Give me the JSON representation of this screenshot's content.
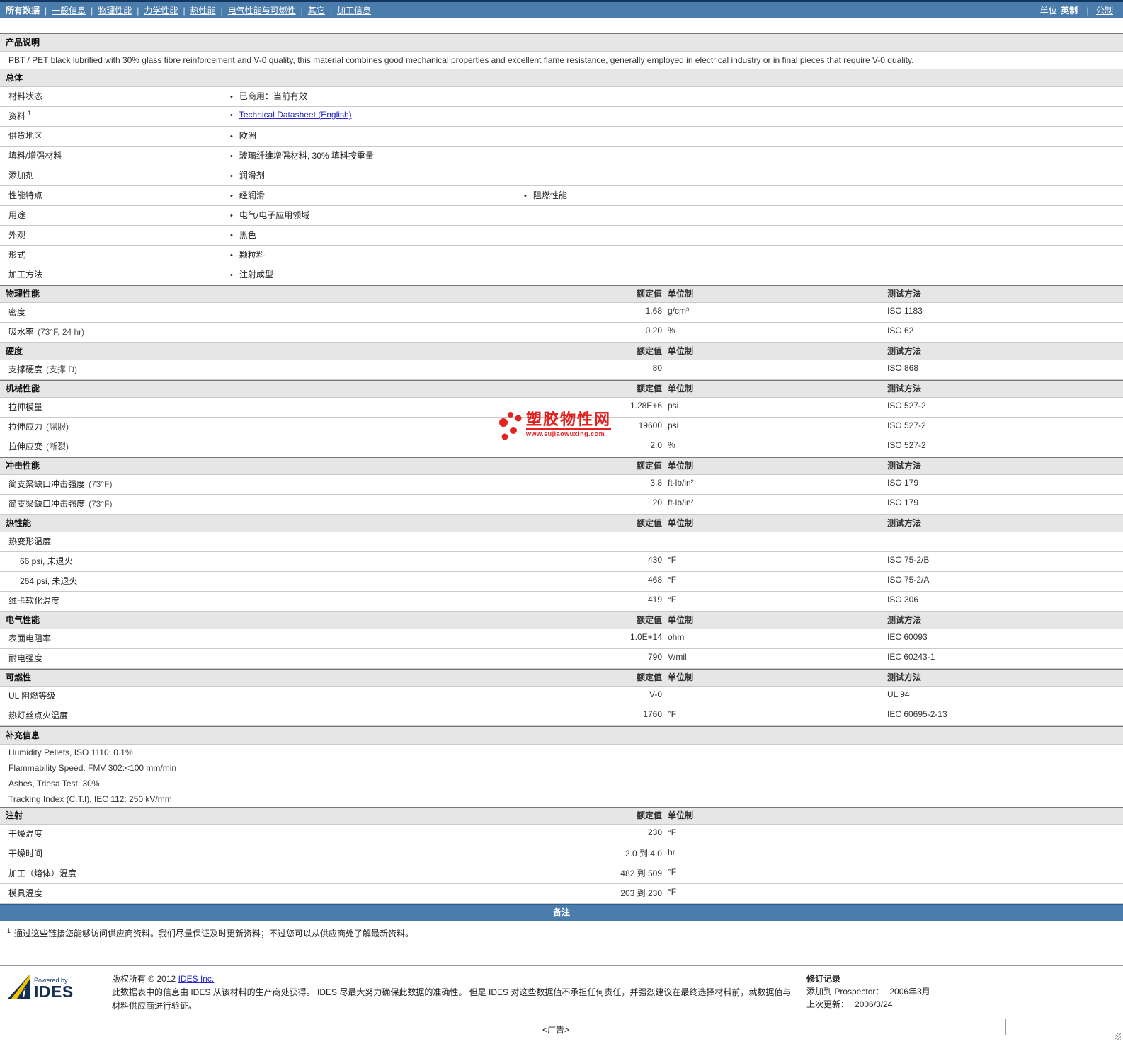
{
  "nav": {
    "tabs": [
      {
        "label": "所有数据",
        "active": true
      },
      {
        "label": "一般信息",
        "active": false
      },
      {
        "label": "物理性能",
        "active": false
      },
      {
        "label": "力学性能",
        "active": false
      },
      {
        "label": "热性能",
        "active": false
      },
      {
        "label": "电气性能与可燃性",
        "active": false
      },
      {
        "label": "其它",
        "active": false
      },
      {
        "label": "加工信息",
        "active": false
      }
    ],
    "units_label": "单位",
    "unit_current": "英制",
    "unit_alt": "公制"
  },
  "product": {
    "section_title": "产品说明",
    "description": "PBT / PET black lubrified with 30% glass fibre reinforcement and V-0 quality, this material combines good mechanical properties and excellent flame resistance, generally employed in electrical industry or in final pieces that require V-0 quality."
  },
  "general": {
    "section_title": "总体",
    "rows": [
      {
        "label": "材料状态",
        "sup": "",
        "bullets": [
          {
            "text": "已商用：当前有效",
            "link": false
          }
        ]
      },
      {
        "label": "资料",
        "sup": "1",
        "bullets": [
          {
            "text": "Technical Datasheet (English)",
            "link": true
          }
        ]
      },
      {
        "label": "供货地区",
        "sup": "",
        "bullets": [
          {
            "text": "欧洲",
            "link": false
          }
        ]
      },
      {
        "label": "填料/增强材料",
        "sup": "",
        "bullets": [
          {
            "text": "玻璃纤维增强材料, 30% 填料按重量",
            "link": false
          }
        ]
      },
      {
        "label": "添加剂",
        "sup": "",
        "bullets": [
          {
            "text": "润滑剂",
            "link": false
          }
        ]
      },
      {
        "label": "性能特点",
        "sup": "",
        "bullets": [
          {
            "text": "经润滑",
            "link": false
          },
          {
            "text": "阻燃性能",
            "link": false
          }
        ]
      },
      {
        "label": "用途",
        "sup": "",
        "bullets": [
          {
            "text": "电气/电子应用领域",
            "link": false
          }
        ]
      },
      {
        "label": "外观",
        "sup": "",
        "bullets": [
          {
            "text": "黑色",
            "link": false
          }
        ]
      },
      {
        "label": "形式",
        "sup": "",
        "bullets": [
          {
            "text": "颗粒料",
            "link": false
          }
        ]
      },
      {
        "label": "加工方法",
        "sup": "",
        "bullets": [
          {
            "text": "注射成型",
            "link": false
          }
        ]
      }
    ]
  },
  "columns": {
    "value": "额定值",
    "unit": "单位制",
    "method": "测试方法"
  },
  "property_sections": [
    {
      "title": "物理性能",
      "rows": [
        {
          "label": "密度",
          "cond": "",
          "value": "1.68",
          "unit": "g/cm³",
          "method": "ISO 1183"
        },
        {
          "label": "吸水率",
          "cond": "(73°F, 24 hr)",
          "value": "0.20",
          "unit": "%",
          "method": "ISO 62"
        }
      ]
    },
    {
      "title": "硬度",
      "rows": [
        {
          "label": "支撑硬度",
          "cond": "(支撑 D)",
          "value": "80",
          "unit": "",
          "method": "ISO 868"
        }
      ]
    },
    {
      "title": "机械性能",
      "rows": [
        {
          "label": "拉伸模量",
          "cond": "",
          "value": "1.28E+6",
          "unit": "psi",
          "method": "ISO 527-2"
        },
        {
          "label": "拉伸应力",
          "cond": "(屈服)",
          "value": "19600",
          "unit": "psi",
          "method": "ISO 527-2"
        },
        {
          "label": "拉伸应变",
          "cond": "(断裂)",
          "value": "2.0",
          "unit": "%",
          "method": "ISO 527-2"
        }
      ]
    },
    {
      "title": "冲击性能",
      "rows": [
        {
          "label": "简支梁缺口冲击强度",
          "cond": "(73°F)",
          "value": "3.8",
          "unit": "ft·lb/in²",
          "method": "ISO 179"
        },
        {
          "label": "简支梁缺口冲击强度",
          "cond": "(73°F)",
          "value": "20",
          "unit": "ft·lb/in²",
          "method": "ISO 179"
        }
      ]
    },
    {
      "title": "热性能",
      "rows": [
        {
          "label": "热变形温度",
          "cond": "",
          "value": "",
          "unit": "",
          "method": "",
          "subheader": true
        },
        {
          "label": "66 psi, 未退火",
          "cond": "",
          "value": "430",
          "unit": "°F",
          "method": "ISO 75-2/B",
          "indent": true
        },
        {
          "label": "264 psi, 未退火",
          "cond": "",
          "value": "468",
          "unit": "°F",
          "method": "ISO 75-2/A",
          "indent": true
        },
        {
          "label": "维卡软化温度",
          "cond": "",
          "value": "419",
          "unit": "°F",
          "method": "ISO 306"
        }
      ]
    },
    {
      "title": "电气性能",
      "rows": [
        {
          "label": "表面电阻率",
          "cond": "",
          "value": "1.0E+14",
          "unit": "ohm",
          "method": "IEC 60093"
        },
        {
          "label": "耐电强度",
          "cond": "",
          "value": "790",
          "unit": "V/mil",
          "method": "IEC 60243-1"
        }
      ]
    },
    {
      "title": "可燃性",
      "rows": [
        {
          "label": "UL 阻燃等级",
          "cond": "",
          "value": "V-0",
          "unit": "",
          "method": "UL 94"
        },
        {
          "label": "热灯丝点火温度",
          "cond": "",
          "value": "1760",
          "unit": "°F",
          "method": "IEC 60695-2-13"
        }
      ]
    }
  ],
  "supplementary": {
    "title": "补充信息",
    "lines": [
      "Humidity Pellets, ISO 1110: 0.1%",
      "Flammability Speed, FMV 302:<100 mm/min",
      "Ashes, Triesa Test: 30%",
      "Tracking Index (C.T.I), IEC 112: 250 kV/mm"
    ]
  },
  "injection": {
    "title": "注射",
    "rows": [
      {
        "label": "干燥温度",
        "value": "230",
        "unit": "°F"
      },
      {
        "label": "干燥时间",
        "value": "2.0 到  4.0",
        "unit": "hr"
      },
      {
        "label": "加工（熔体）温度",
        "value": "482 到  509",
        "unit": "°F"
      },
      {
        "label": "模具温度",
        "value": "203 到  230",
        "unit": "°F"
      }
    ]
  },
  "notes": {
    "bar_title": "备注",
    "footnote_sup": "1",
    "footnote": "通过这些链接您能够访问供应商资料。我们尽量保证及时更新资料；不过您可以从供应商处了解最新资料。"
  },
  "footer": {
    "powered_by": "Powered by",
    "logo_text": "IDES",
    "copyright_prefix": "版权所有  © 2012",
    "copyright_link": "IDES Inc.",
    "disclaimer": "此数据表中的信息由  IDES 从该材料的生产商处获得。 IDES 尽最大努力确保此数据的准确性。 但是  IDES 对这些数据值不承担任何责任，并强烈建议在最终选择材料前，就数据值与材料供应商进行验证。",
    "revision_title": "修订记录",
    "added_label": "添加到  Prospector：",
    "added_value": "2006年3月",
    "updated_label": "上次更新：",
    "updated_value": "2006/3/24"
  },
  "watermark": {
    "title": "塑胶物性网",
    "url": "www.sujiaowuxing.com",
    "color": "#E32222"
  },
  "ad_label": "<广告>"
}
